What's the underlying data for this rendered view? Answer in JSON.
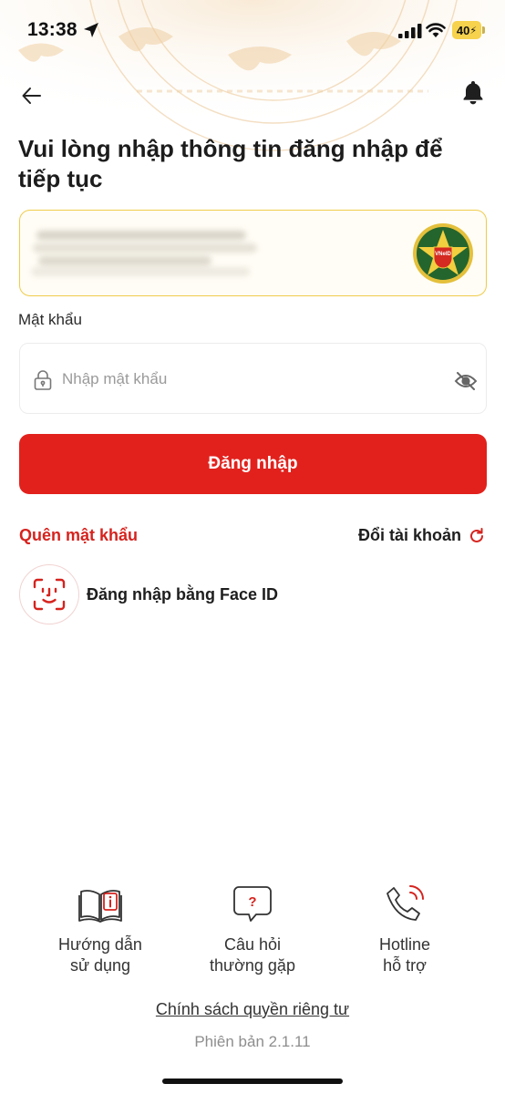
{
  "status_bar": {
    "time": "13:38",
    "battery": "40",
    "battery_color": "#f6d24d"
  },
  "header": {
    "back_icon": "arrow-left-icon",
    "bell_icon": "bell-icon"
  },
  "login": {
    "heading": "Vui lòng nhập thông tin đăng nhập để tiếp tục",
    "password_label": "Mật khẩu",
    "password_placeholder": "Nhập mật khẩu",
    "login_button": "Đăng nhập",
    "forgot_password": "Quên mật khẩu",
    "switch_account": "Đổi tài khoản",
    "face_id": "Đăng nhập bằng Face ID",
    "emblem_text": "VNeID"
  },
  "footer": {
    "links": [
      {
        "icon": "book-info-icon",
        "line1": "Hướng dẫn",
        "line2": "sử dụng"
      },
      {
        "icon": "question-bubble-icon",
        "line1": "Câu hỏi",
        "line2": "thường gặp"
      },
      {
        "icon": "phone-hotline-icon",
        "line1": "Hotline",
        "line2": "hỗ trợ"
      }
    ],
    "privacy": "Chính sách quyền riêng tư",
    "version": "Phiên bản 2.1.11"
  },
  "colors": {
    "primary_red": "#e2211c",
    "link_red": "#d6231e",
    "card_border": "#f0cb4b"
  }
}
